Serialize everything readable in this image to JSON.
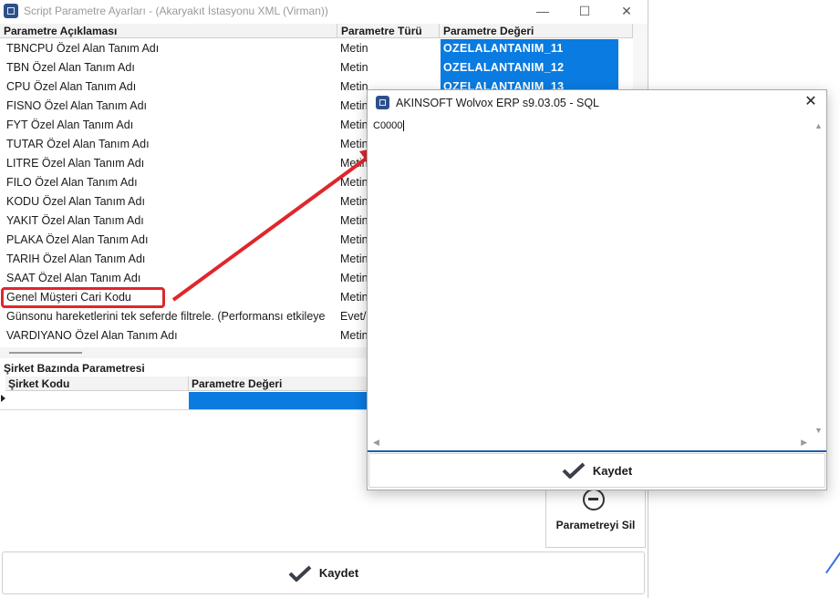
{
  "main_window": {
    "title": "Script Parametre Ayarları - (Akaryakıt İstasyonu XML (Virman))",
    "controls": {
      "minimize": "—",
      "maximize": "☐",
      "close": "✕"
    }
  },
  "param_grid": {
    "columns": [
      "Parametre Açıklaması",
      "Parametre Türü",
      "Parametre Değeri"
    ],
    "rows": [
      {
        "desc": "TBNCPU Özel Alan Tanım Adı",
        "type": "Metin",
        "value": "OZELALANTANIM_11"
      },
      {
        "desc": "TBN Özel Alan Tanım Adı",
        "type": "Metin",
        "value": "OZELALANTANIM_12"
      },
      {
        "desc": "CPU Özel Alan Tanım Adı",
        "type": "Metin",
        "value": "OZELALANTANIM_13"
      },
      {
        "desc": "FISNO Özel Alan Tanım Adı",
        "type": "Metin",
        "value": ""
      },
      {
        "desc": "FYT Özel Alan Tanım Adı",
        "type": "Metin",
        "value": ""
      },
      {
        "desc": "TUTAR Özel Alan Tanım Adı",
        "type": "Metin",
        "value": ""
      },
      {
        "desc": "LITRE Özel Alan Tanım Adı",
        "type": "Metin",
        "value": ""
      },
      {
        "desc": "FILO Özel Alan Tanım Adı",
        "type": "Metin",
        "value": ""
      },
      {
        "desc": "KODU Özel Alan Tanım Adı",
        "type": "Metin",
        "value": ""
      },
      {
        "desc": "YAKIT Özel Alan Tanım Adı",
        "type": "Metin",
        "value": ""
      },
      {
        "desc": "PLAKA Özel Alan Tanım Adı",
        "type": "Metin",
        "value": ""
      },
      {
        "desc": "TARIH Özel Alan Tanım Adı",
        "type": "Metin",
        "value": ""
      },
      {
        "desc": "SAAT Özel Alan Tanım Adı",
        "type": "Metin",
        "value": ""
      },
      {
        "desc": "Genel Müşteri Cari Kodu",
        "type": "Metin",
        "value": ""
      },
      {
        "desc": "Günsonu hareketlerini tek seferde filtrele. (Performansı etkileye",
        "type": "Evet/",
        "value": ""
      },
      {
        "desc": "VARDIYANO Özel Alan Tanım Adı",
        "type": "Metin",
        "value": ""
      }
    ]
  },
  "company_section": {
    "title": "Şirket Bazında Parametresi",
    "columns": [
      "Şirket Kodu",
      "Parametre Değeri"
    ]
  },
  "buttons": {
    "delete_param": "Parametreyi Sil",
    "save_main": "Kaydet"
  },
  "dialog": {
    "title": "AKINSOFT Wolvox ERP s9.03.05 - SQL",
    "text_value": "C0000",
    "close": "✕",
    "save": "Kaydet"
  },
  "colors": {
    "selection_blue": "#0a7be0",
    "highlight_red": "#e0262b"
  }
}
